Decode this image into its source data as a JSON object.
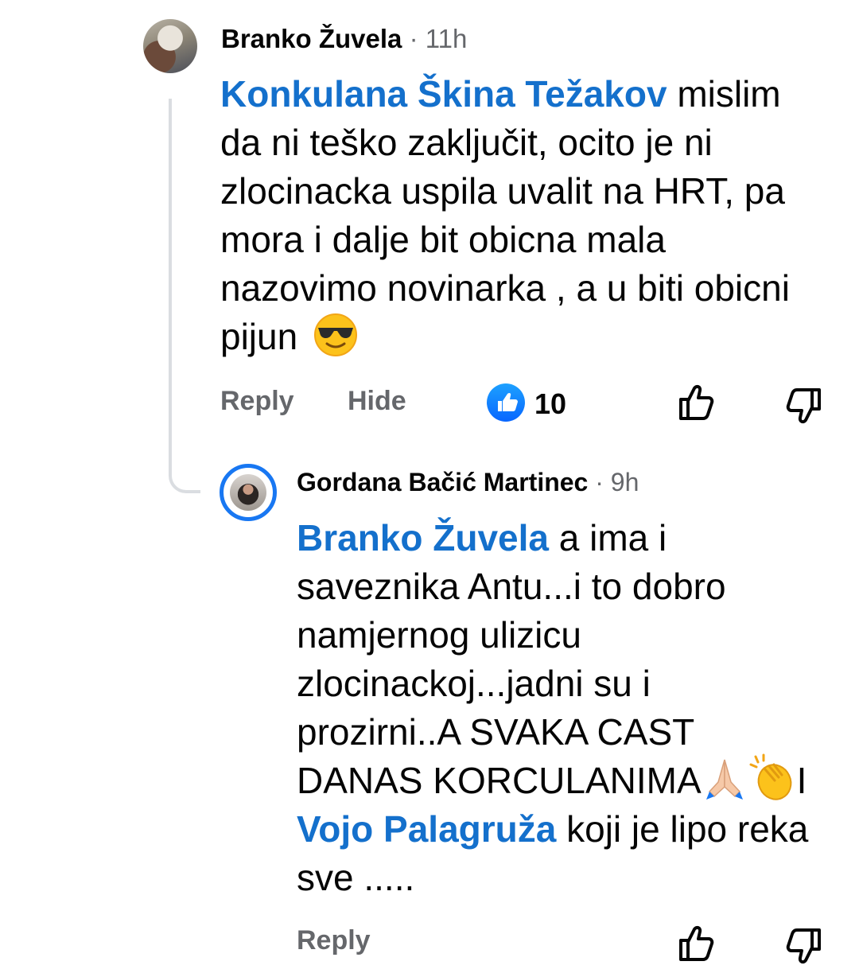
{
  "comment1": {
    "author": "Branko Žuvela",
    "separator": "·",
    "time": "11h",
    "mention": "Konkulana Škina Težakov",
    "lines": [
      " mislim",
      "da ni teško zaključit, ocito je ni",
      "zlocinacka uspila uvalit na HRT, pa",
      "mora i dalje bit obicna mala",
      "nazovimo novinarka , a u biti obicni",
      "pijun"
    ],
    "emoji": "smiling-face-with-sunglasses",
    "actions": {
      "reply": "Reply",
      "hide": "Hide"
    },
    "reactions": {
      "type": "like",
      "count": "10"
    }
  },
  "comment2": {
    "author": "Gordana Bačić Martinec",
    "separator": "·",
    "time": "9h",
    "mention1": "Branko Žuvela",
    "line1_rest": " a ima i",
    "lines": [
      "saveznika Antu...i to dobro",
      "namjernog  ulizicu",
      "zlocinackoj...jadni su i",
      "prozirni..A SVAKA CAST",
      "DANAS KORCULANIMA"
    ],
    "line6_tail": "I",
    "emojis": [
      "folded-hands",
      "clapping-hands"
    ],
    "mention2": "Vojo Palagruža",
    "line7_rest": " koji je lipo reka",
    "last_line": "sve .....",
    "actions": {
      "reply": "Reply"
    }
  },
  "icons": {
    "like": "thumbs-up-icon",
    "dislike": "thumbs-down-icon",
    "like_badge": "like-reaction-icon"
  },
  "colors": {
    "mention": "#1470cc",
    "like_blue": "#1877f2",
    "secondary_text": "#65676b"
  }
}
